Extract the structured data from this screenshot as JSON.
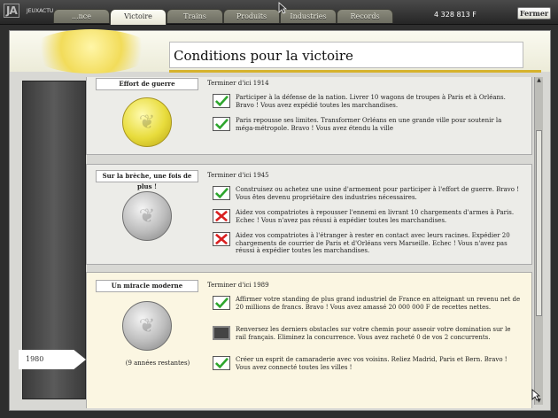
{
  "logo": {
    "ja": "JA",
    "site": "JEUXACTU.com"
  },
  "tabs": [
    {
      "label": "...nce",
      "active": false
    },
    {
      "label": "Victoire",
      "active": true
    },
    {
      "label": "Trains",
      "active": false
    },
    {
      "label": "Produits",
      "active": false
    },
    {
      "label": "Industries",
      "active": false
    },
    {
      "label": "Records",
      "active": false
    }
  ],
  "money": "4 328 813 F",
  "close_label": "Fermer",
  "page_title": "Conditions pour la victoire",
  "year": "1980",
  "colors": {
    "accent": "#d6b22c",
    "check": "#2ea62e",
    "cross": "#d92020"
  },
  "scroll": {
    "up": "▲",
    "down": "▼"
  },
  "eras": [
    {
      "name": "Effort de guerre",
      "deadline": "Terminer d'ici 1914",
      "medal": "gold",
      "objectives": [
        {
          "status": "done",
          "text": "Participer à la défense de la nation. Livrer 10 wagons de troupes à Paris et à Orléans. Bravo ! Vous avez expédié toutes les marchandises."
        },
        {
          "status": "done",
          "text": "Paris repousse ses limites. Transformer Orléans en une grande ville pour soutenir la méga-métropole. Bravo ! Vous avez étendu la ville"
        }
      ]
    },
    {
      "name": "Sur la brèche, une fois de plus !",
      "deadline": "Terminer d'ici 1945",
      "medal": "silver",
      "objectives": [
        {
          "status": "done",
          "text": "Construisez ou achetez une usine d'armement pour participer à l'effort de guerre. Bravo ! Vous êtes devenu propriétaire des industries nécessaires."
        },
        {
          "status": "failed",
          "text": "Aidez vos compatriotes à repousser l'ennemi en livrant 10 chargements d'armes à Paris. Echec ! Vous n'avez pas réussi à expédier toutes les marchandises."
        },
        {
          "status": "failed",
          "text": "Aidez vos compatriotes à l'étranger à rester en contact avec leurs racines. Expédier 20 chargements de courrier de Paris et d'Orléans vers Marseille. Echec ! Vous n'avez pas réussi à expédier toutes les marchandises."
        }
      ]
    },
    {
      "name": "Un miracle moderne",
      "deadline": "Terminer d'ici 1989",
      "medal": "silver",
      "remaining": "(9 années restantes)",
      "objectives": [
        {
          "status": "done",
          "text": "Affirmer votre standing de plus grand industriel de France en atteignant un revenu net de 20 millions de francs. Bravo ! Vous avez amassé  20 000 000 F de recettes nettes."
        },
        {
          "status": "pending",
          "text": "Renversez les derniers obstacles sur votre chemin pour asseoir votre domination sur le rail français. Eliminez la concurrence. Vous avez racheté 0 de vos 2 concurrents."
        },
        {
          "status": "done",
          "text": "Créer un esprit de camaraderie avec vos voisins. Reliez Madrid, Paris et Bern. Bravo ! Vous avez connecté toutes les villes !"
        }
      ]
    }
  ]
}
